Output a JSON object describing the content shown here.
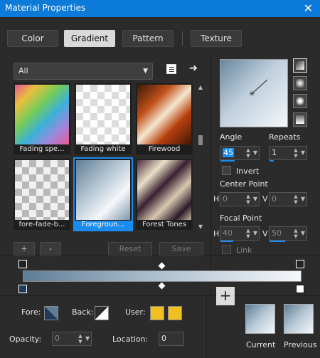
{
  "window": {
    "title": "Material Properties",
    "close_glyph": "✕"
  },
  "tabs": [
    {
      "label": "Color",
      "active": false
    },
    {
      "label": "Gradient",
      "active": true
    },
    {
      "label": "Pattern",
      "active": false
    },
    {
      "label": "Texture",
      "active": false
    }
  ],
  "filter": {
    "value": "All"
  },
  "thumbnails": [
    {
      "label": "Fading spe...",
      "selected": false
    },
    {
      "label": "Fading white",
      "selected": false
    },
    {
      "label": "Firewood",
      "selected": false
    },
    {
      "label": "fore-fade-b...",
      "selected": false
    },
    {
      "label": "Foregroun...",
      "selected": true
    },
    {
      "label": "Forest Tones",
      "selected": false
    }
  ],
  "list_buttons": {
    "add": "+",
    "remove": "-",
    "reset": "Reset",
    "save": "Save"
  },
  "angle": {
    "label": "Angle",
    "value": "45"
  },
  "repeats": {
    "label": "Repeats",
    "value": "1"
  },
  "invert": {
    "label": "Invert",
    "checked": false
  },
  "center_point": {
    "label": "Center Point",
    "h_label": "H",
    "h_value": "0",
    "v_label": "V",
    "v_value": "0"
  },
  "focal_point": {
    "label": "Focal Point",
    "h_label": "H",
    "h_value": "40",
    "v_label": "V",
    "v_value": "50"
  },
  "link": {
    "label": "Link",
    "checked": false
  },
  "bottom": {
    "fore_label": "Fore:",
    "back_label": "Back:",
    "user_label": "User:",
    "opacity_label": "Opacity:",
    "opacity_value": "0",
    "location_label": "Location:",
    "location_value": "0",
    "current_label": "Current",
    "previous_label": "Previous"
  },
  "colors": {
    "accent": "#1b8bf0",
    "user": "#f0c020",
    "fore": "#1f3b5c"
  }
}
